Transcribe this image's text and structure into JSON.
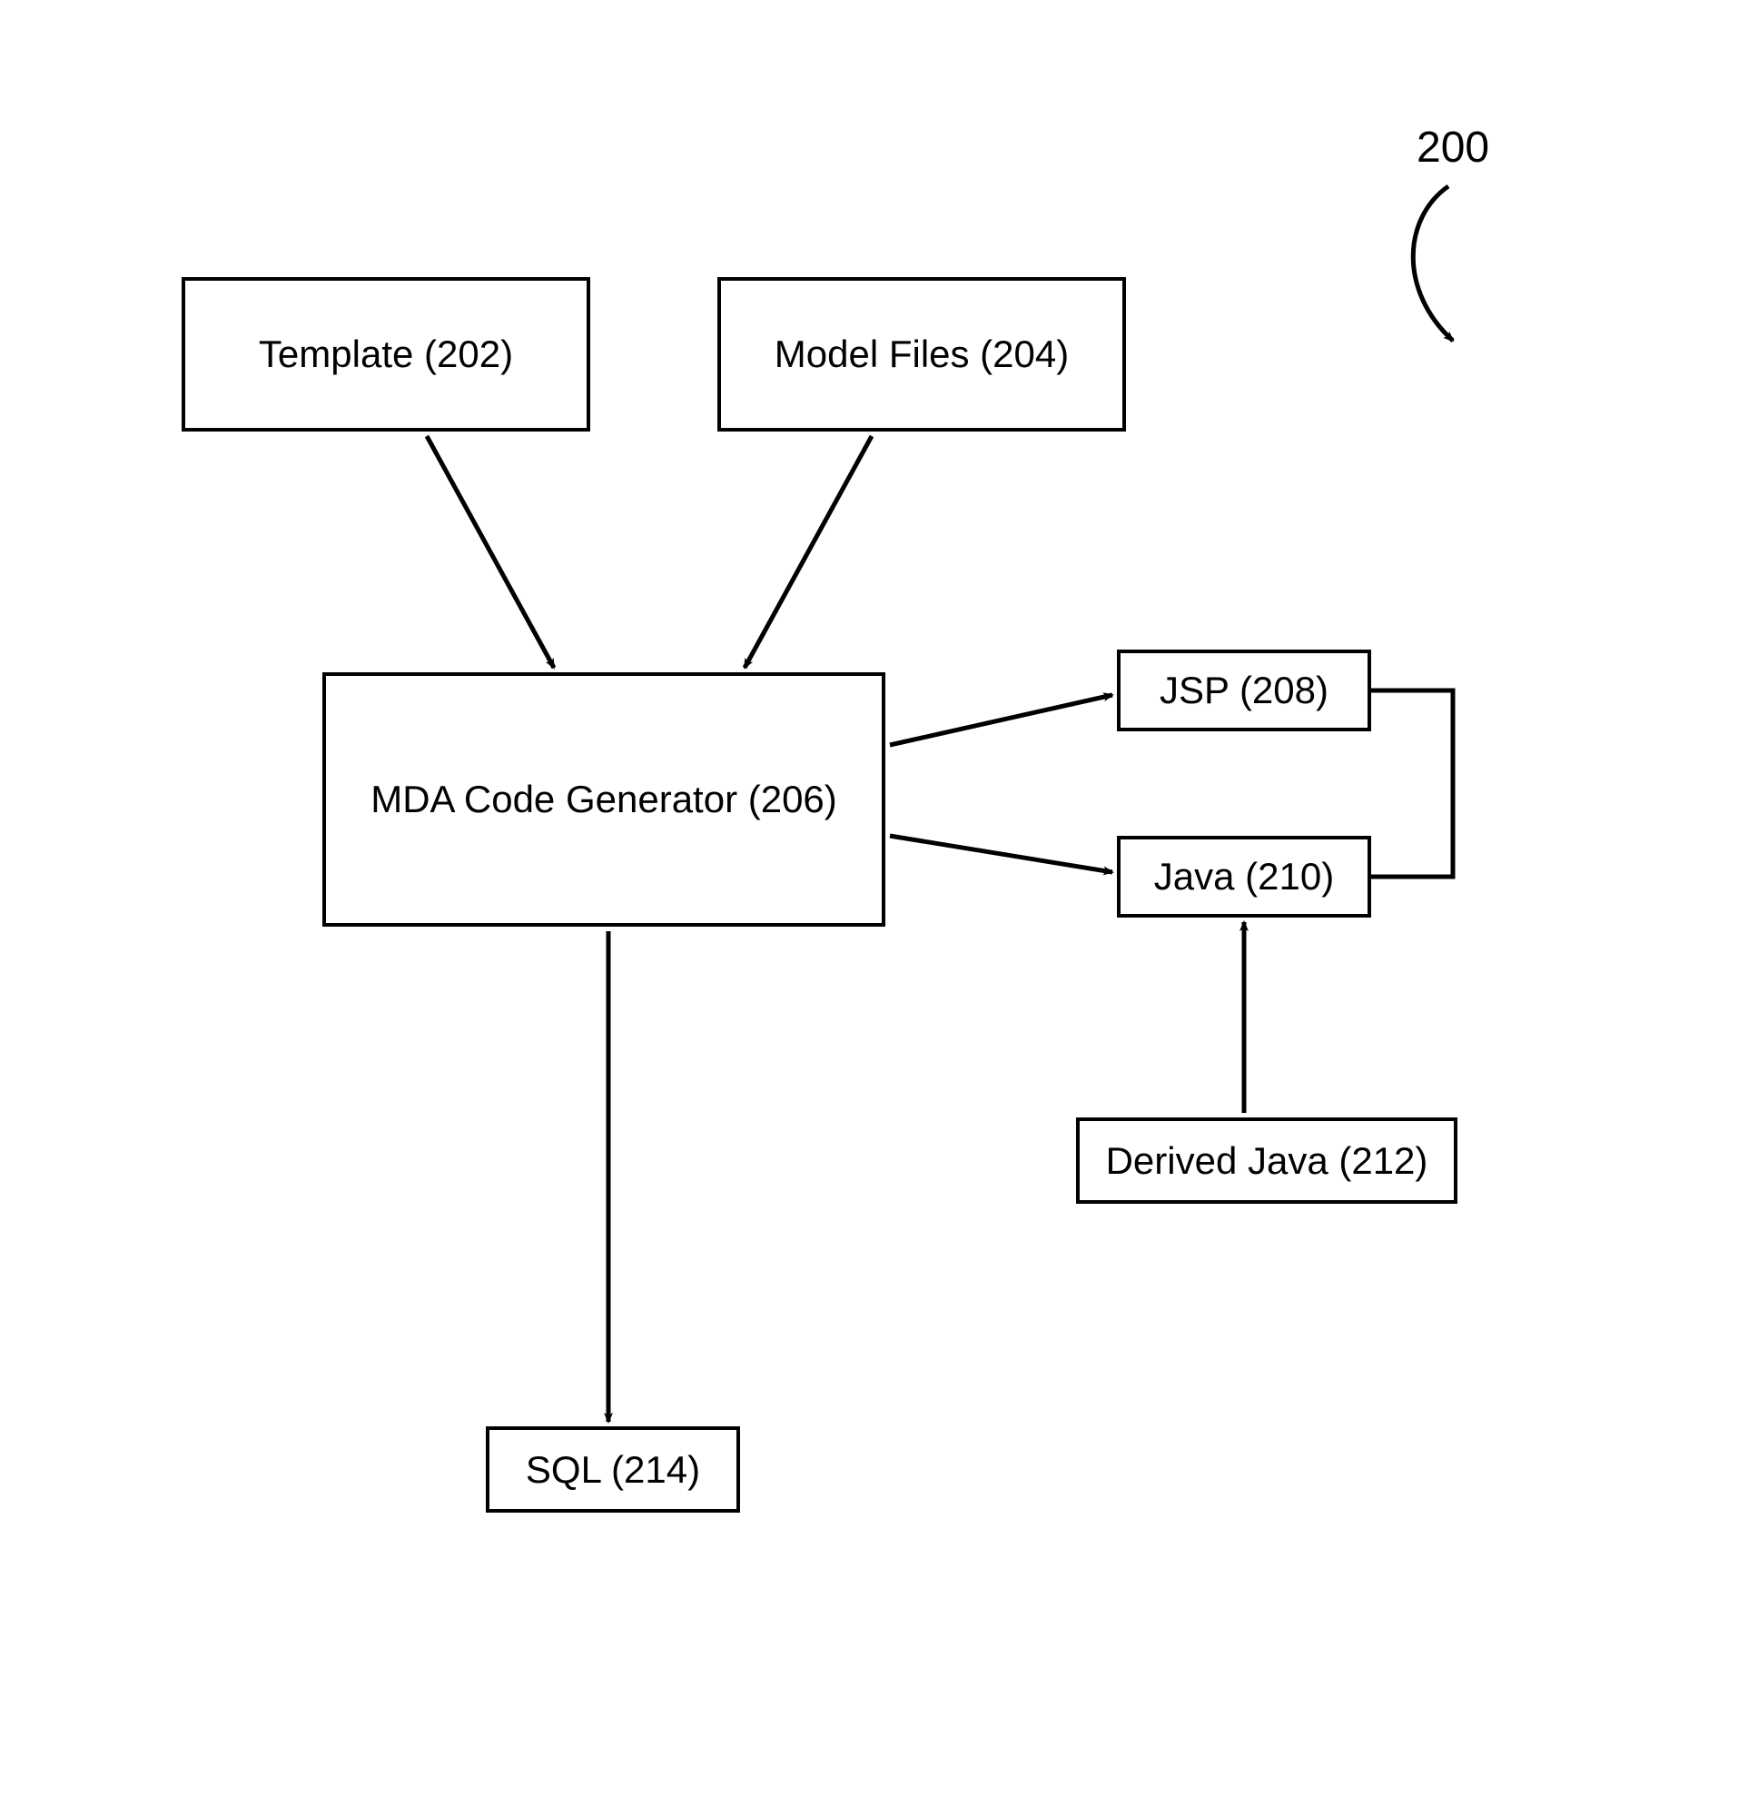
{
  "figure_label": "200",
  "boxes": {
    "template": {
      "label": "Template (202)"
    },
    "model_files": {
      "label": "Model Files (204)"
    },
    "mda_generator": {
      "label": "MDA Code Generator (206)"
    },
    "jsp": {
      "label": "JSP (208)"
    },
    "java": {
      "label": "Java (210)"
    },
    "derived_java": {
      "label": "Derived Java (212)"
    },
    "sql": {
      "label": "SQL (214)"
    }
  }
}
